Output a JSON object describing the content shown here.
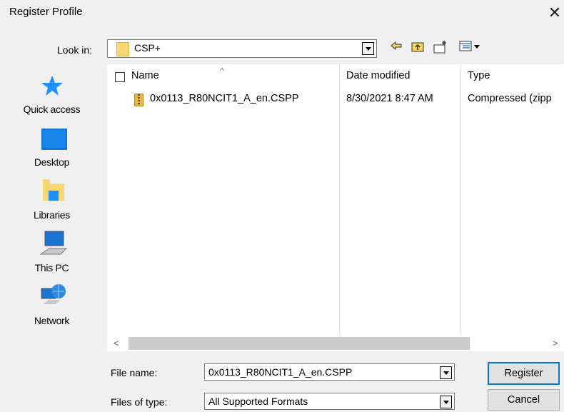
{
  "window": {
    "title": "Register Profile"
  },
  "look_in": {
    "label": "Look in:",
    "value": "CSP+"
  },
  "toolbar": {
    "icons": [
      "back-icon",
      "up-folder-icon",
      "new-folder-icon",
      "view-menu-icon"
    ]
  },
  "places": [
    {
      "label": "Quick access",
      "icon": "quick-access-icon"
    },
    {
      "label": "Desktop",
      "icon": "desktop-icon"
    },
    {
      "label": "Libraries",
      "icon": "libraries-icon"
    },
    {
      "label": "This PC",
      "icon": "this-pc-icon"
    },
    {
      "label": "Network",
      "icon": "network-icon"
    }
  ],
  "columns": {
    "name": "Name",
    "date": "Date modified",
    "type": "Type"
  },
  "files": [
    {
      "name": "0x0113_R80NCIT1_A_en.CSPP",
      "date": "8/30/2021 8:47 AM",
      "type": "Compressed (zipp"
    }
  ],
  "file_name": {
    "label": "File name:",
    "value": "0x0113_R80NCIT1_A_en.CSPP"
  },
  "file_type": {
    "label": "Files of type:",
    "value": "All Supported Formats"
  },
  "buttons": {
    "register": "Register",
    "cancel": "Cancel"
  },
  "colors": {
    "accent": "#0078d7",
    "folder": "#f8d775",
    "quick_access": "#1e90ff"
  }
}
